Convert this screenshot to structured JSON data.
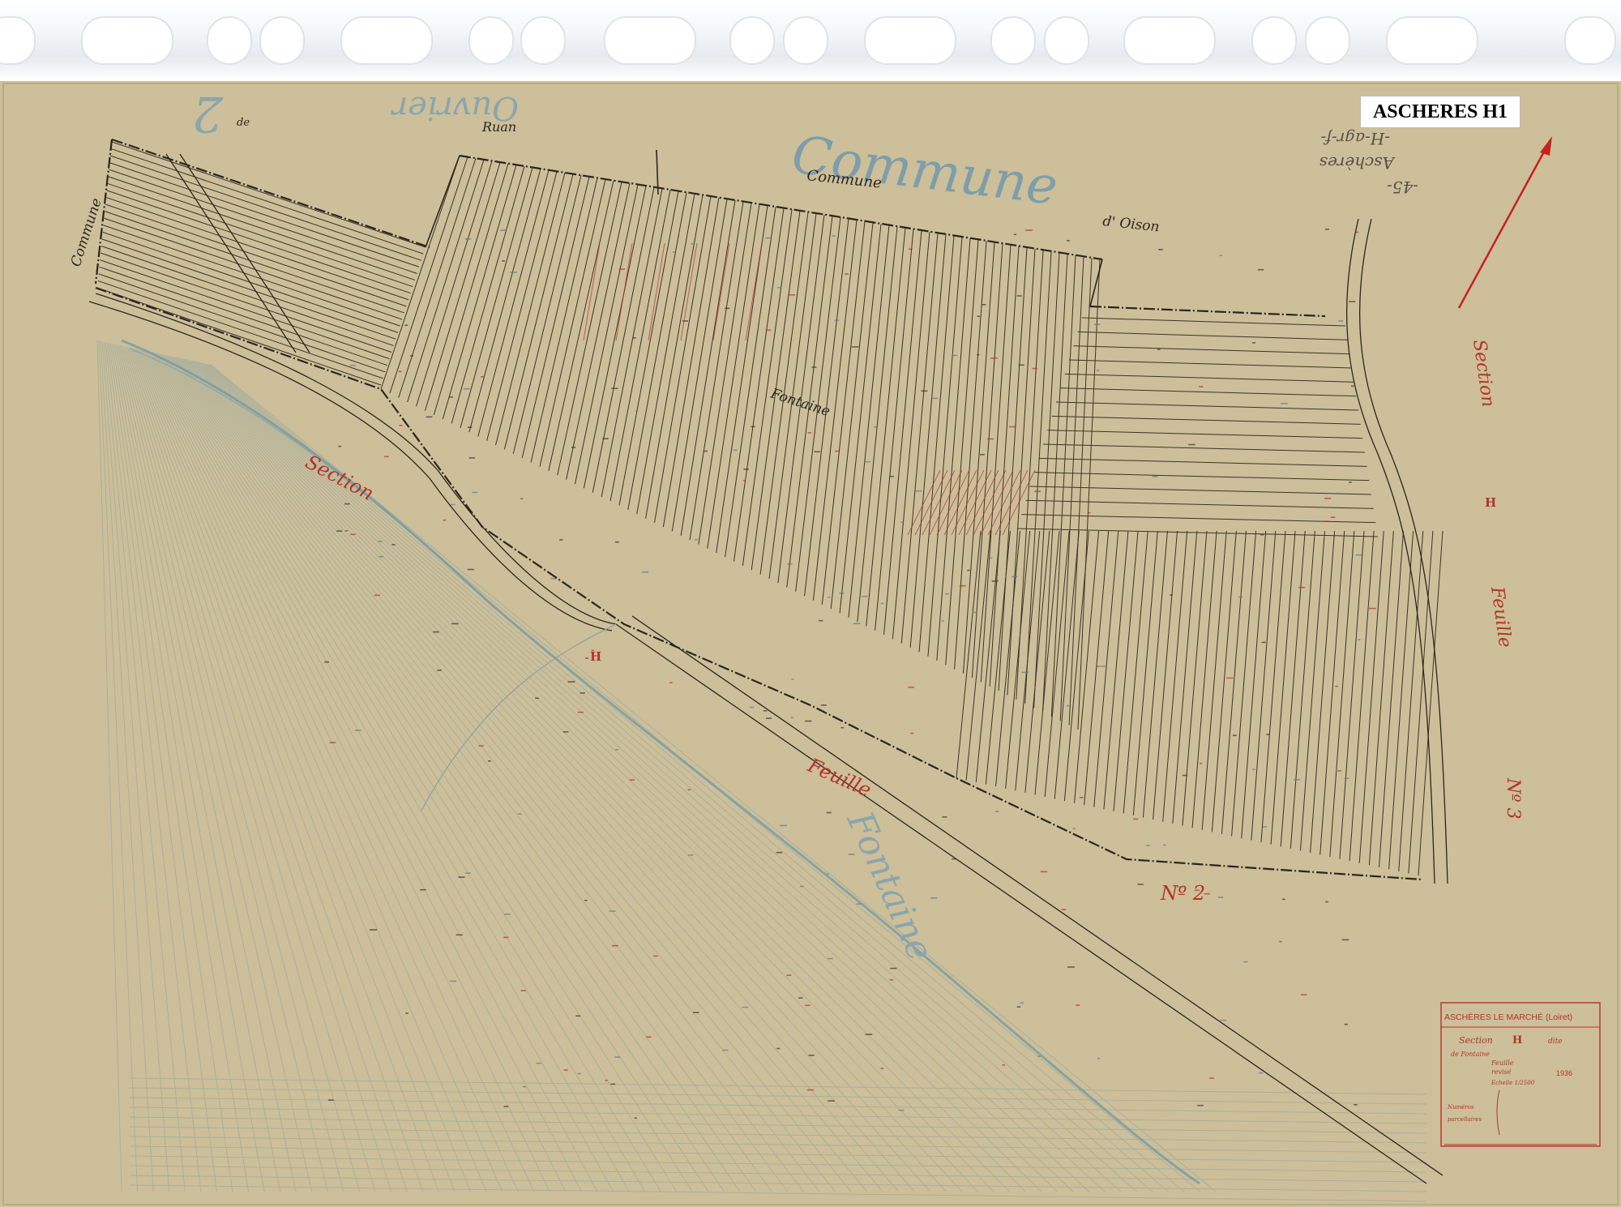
{
  "sheet_label": "ASCHERES H1",
  "map": {
    "commune_large": "Commune",
    "commune_small": "Commune",
    "commune_left": "Commune",
    "oison": "d' Oison",
    "ruan": "Ruan",
    "de": "de",
    "ouvrier_mirrored": "Ouvrier",
    "fontaine": "Fontaine",
    "fontaine_large": "Fontaine",
    "section_left": "Section",
    "section_right": "Section",
    "feuille_lower": "Feuille",
    "feuille_right": "Feuille",
    "h_center": "H",
    "h_right": "H",
    "no2": "Nº 2",
    "no3": "Nº 3",
    "reverse_note": [
      "-45-",
      "Aschères",
      "-H-agr-f-"
    ]
  },
  "cartouche": {
    "title": "ASCHÈRES LE MARCHÉ (Loiret)",
    "section_label": "Section",
    "section_letter": "H",
    "lieu": "dite",
    "line1": "de Fontaine",
    "line2": "Feuille",
    "line3": "revisé",
    "year": "1936",
    "echelle": "Echelle 1/2500",
    "numeros": "Numéros",
    "parcellaires": "parcellaires"
  },
  "colors": {
    "paper": "#cdbf99",
    "ink_black": "#2a2620",
    "ink_red": "#b3342a",
    "ink_blue": "#6f9aa6",
    "arrow": "#c8211e"
  }
}
